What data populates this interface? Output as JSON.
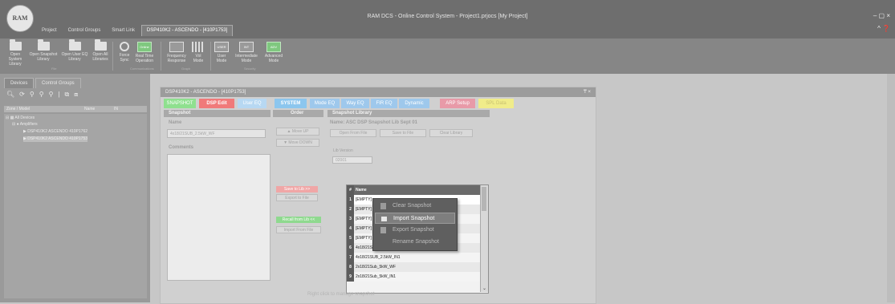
{
  "app_title": "RAM DCS - Online Control System - Project1.prjocs [My Project]",
  "logo_text": "RAM",
  "window_controls": "– ▢ ×",
  "help_controls": "^ ❓",
  "menu_tabs": [
    "Project",
    "Control Groups",
    "Smart Link",
    "DSP410K2 - ASCENDO - [410P1753]"
  ],
  "ribbon": {
    "buttons": [
      {
        "label1": "Open System",
        "label2": "Library"
      },
      {
        "label1": "Open Snapshot",
        "label2": "Library"
      },
      {
        "label1": "Open User EQ",
        "label2": "Library"
      },
      {
        "label1": "Open All",
        "label2": "Libraries"
      },
      {
        "label1": "Force",
        "label2": "Sync"
      },
      {
        "label1": "Real Time",
        "label2": "Operation",
        "icon_text": "Online"
      },
      {
        "label1": "Frequency",
        "label2": "Response"
      },
      {
        "label1": "Vol",
        "label2": "Mode"
      },
      {
        "label1": "User",
        "label2": "Mode",
        "icon_text": "USER"
      },
      {
        "label1": "Intermediate",
        "label2": "Mode",
        "icon_text": "INT"
      },
      {
        "label1": "Advanced",
        "label2": "Mode",
        "icon_text": "ADV"
      }
    ],
    "groups": [
      "File",
      "Communications",
      "Graph",
      "Security"
    ]
  },
  "left_panel": {
    "tabs": [
      "Devices",
      "Control Groups"
    ],
    "columns": [
      "Zone / Model",
      "Name",
      "IN"
    ],
    "tree": {
      "root": "All Devices",
      "group": "Amplifiers",
      "devices": [
        "DSP410K2   ASCENDO   410P1762",
        "DSP410K2   ASCENDO   410P1753"
      ]
    }
  },
  "dsp_window": {
    "title": "DSP410K2 - ASCENDO - [410P1753]",
    "controls": "₸ ×",
    "tabs": [
      {
        "label": "SNAPSHOT",
        "color": "#8fe08f"
      },
      {
        "label": "DSP Edit",
        "color": "#f07a7a"
      },
      {
        "label": "User EQ",
        "color": "#b7d8f2"
      },
      {
        "label": "SYSTEM",
        "color": "#8cc6ee"
      },
      {
        "label": "Mode EQ",
        "color": "#9ec8ec"
      },
      {
        "label": "Way EQ",
        "color": "#9ec8ec"
      },
      {
        "label": "FIR EQ",
        "color": "#9ec8ec"
      },
      {
        "label": "Dynamic",
        "color": "#9ec8ec"
      },
      {
        "label": "ARP Setup",
        "color": "#e89aa8"
      },
      {
        "label": "SPL Data",
        "color": "#f0ec8a"
      }
    ],
    "snapshot": {
      "header": "Snapshot",
      "name_label": "Name",
      "name_value": "4x18/21SUB_2.5kW_WF",
      "comments_label": "Comments"
    },
    "order": {
      "header": "Order",
      "move_up": "▲ Move UP",
      "move_down": "▼ Move DOWN",
      "save_to_lib": "Save to Lib >>",
      "export_to_file": "Export to File",
      "recall_from_lib": "Recall from Lib <<",
      "import_from_file": "Import From File"
    },
    "library": {
      "header": "Snapshot Library",
      "name": "Name: ASC DSP Snapshot Lib Sept 01",
      "open_from_file": "Open From File",
      "save_to_file": "Save to File",
      "clear_library": "Clear Library",
      "lib_version_label": "Lib Version",
      "lib_version_value": "02001",
      "col_num": "#",
      "col_name": "Name",
      "rows": [
        {
          "num": "1",
          "name": "[EMPTY]"
        },
        {
          "num": "2",
          "name": "[EMPTY]"
        },
        {
          "num": "3",
          "name": "[EMPTY]"
        },
        {
          "num": "4",
          "name": "[EMPTY]"
        },
        {
          "num": "5",
          "name": "[EMPTY]"
        },
        {
          "num": "6",
          "name": "4x18/21SUB_2.5kW_WF"
        },
        {
          "num": "7",
          "name": "4x18/21SUB_2.5kW_IN1"
        },
        {
          "num": "8",
          "name": "2x18/21Sub_5kW_WF"
        },
        {
          "num": "9",
          "name": "2x18/21Sub_5kW_IN1"
        }
      ],
      "hint": "Right click to manage snapshot"
    },
    "context_menu": [
      "Clear Snapshot",
      "Import Snapshot",
      "Export Snapshot",
      "Rename Snapshot"
    ]
  }
}
